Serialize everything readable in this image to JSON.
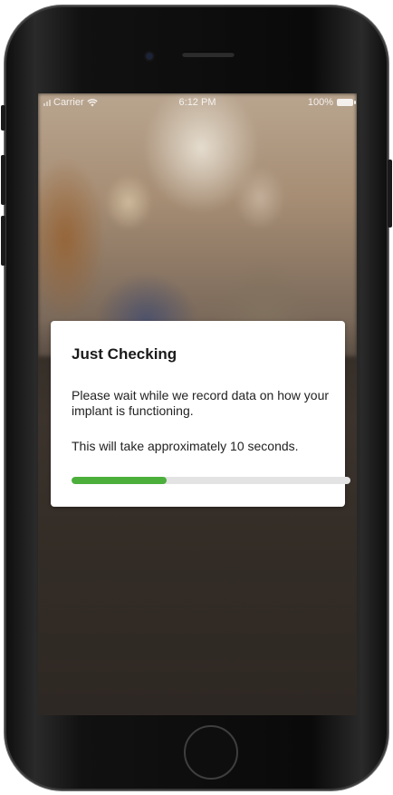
{
  "status_bar": {
    "carrier": "Carrier",
    "time": "6:12 PM",
    "battery": "100%"
  },
  "dialog": {
    "title": "Just Checking",
    "message": "Please wait while we record data on how your implant is functioning.",
    "note": "This will take approximately 10 seconds.",
    "progress_fraction": 0.34,
    "progress_color": "#4caf3c"
  }
}
